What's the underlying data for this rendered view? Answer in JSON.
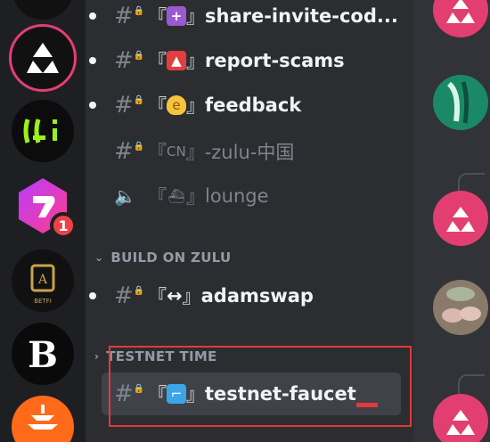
{
  "servers": [
    {
      "name": "server-top-partial"
    },
    {
      "name": "zulu-server",
      "active": true
    },
    {
      "name": "green-face-server"
    },
    {
      "name": "purple-shield-server",
      "badge": "1"
    },
    {
      "name": "betfi-server"
    },
    {
      "name": "b-logo-server"
    },
    {
      "name": "pagoda-server"
    }
  ],
  "channels": [
    {
      "icon": "hash-lock-icon",
      "emoji": "plus-icon",
      "label": "share-invite-cod...",
      "unread": true
    },
    {
      "icon": "hash-lock-icon",
      "emoji": "siren-icon",
      "label": "report-scams",
      "unread": true
    },
    {
      "icon": "hash-lock-icon",
      "emoji": "ear-icon",
      "label": "feedback",
      "unread": true
    },
    {
      "icon": "hash-lock-icon",
      "emoji_text": "CN",
      "label": "-zulu-中国",
      "unread": false
    },
    {
      "icon": "voice-lock-icon",
      "emoji": "boat-icon",
      "label": "lounge",
      "unread": false
    }
  ],
  "category_build": "BUILD ON ZULU",
  "build_channel": {
    "emoji_text": "↔",
    "label": "adamswap"
  },
  "category_testnet": "TESTNET TIME",
  "testnet_channel": {
    "emoji": "faucet-icon",
    "label": "testnet-faucet"
  },
  "bracket_open": "『",
  "bracket_close": "』",
  "badge": "1",
  "colors": {
    "accent": "#e23e71",
    "highlight": "#e5383b",
    "unread_badge": "#ed4245"
  }
}
